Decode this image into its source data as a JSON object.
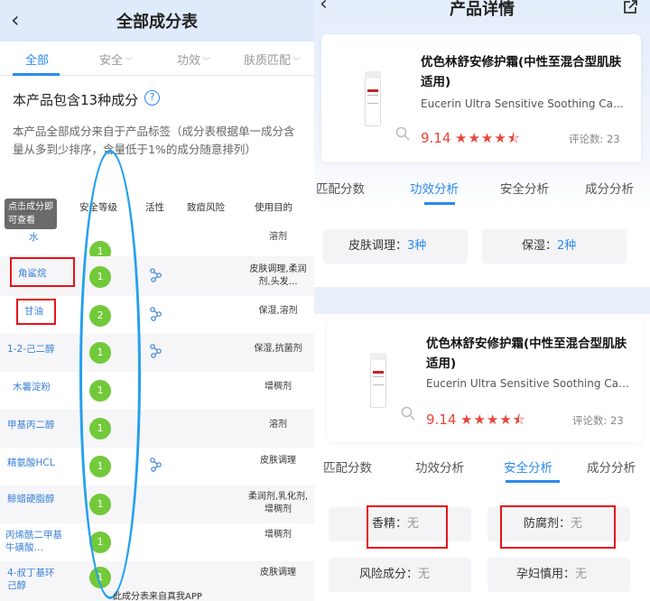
{
  "left": {
    "header": {
      "back": "‹",
      "title": "全部成分表"
    },
    "tabs": [
      {
        "label": "全部",
        "active": true
      },
      {
        "label": "安全",
        "active": false
      },
      {
        "label": "功效",
        "active": false
      },
      {
        "label": "肤质匹配",
        "active": false
      }
    ],
    "count_text": "本产品包含13种成分",
    "help_icon": "question-circle-icon",
    "description": "本产品全部成分来自于产品标签（成分表根据单一成分含量从多到少排序，含量低于1%的成分随意排列）",
    "table_headers": {
      "name": "成分",
      "safety": "安全等级",
      "activity": "活性",
      "acne_risk": "致痘风险",
      "purpose": "使用目的"
    },
    "tooltip": "点击成分即可查看",
    "rows": [
      {
        "name": "水",
        "score": "1",
        "active": false,
        "purpose": "溶剂"
      },
      {
        "name": "角鲨烷",
        "score": "1",
        "active": true,
        "purpose": "皮肤调理,柔润剂,头发…"
      },
      {
        "name": "甘油",
        "score": "2",
        "active": true,
        "purpose": "保湿,溶剂"
      },
      {
        "name": "1-2-己二醇",
        "score": "1",
        "active": true,
        "purpose": "保湿,抗菌剂"
      },
      {
        "name": "木薯淀粉",
        "score": "1",
        "active": false,
        "purpose": "增稠剂"
      },
      {
        "name": "甲基丙二醇",
        "score": "1",
        "active": false,
        "purpose": "溶剂"
      },
      {
        "name": "精氨酸HCL",
        "score": "1",
        "active": true,
        "purpose": "皮肤调理"
      },
      {
        "name": "鲸蜡硬脂醇",
        "score": "1",
        "active": false,
        "purpose": "柔润剂,乳化剂,增稠剂"
      },
      {
        "name": "丙烯酰二甲基牛磺酸…",
        "score": "1",
        "active": false,
        "purpose": "增稠剂"
      },
      {
        "name": "4-叔丁基环己醇",
        "score": "1",
        "active": false,
        "purpose": "皮肤调理"
      }
    ],
    "footer": "此成分表来自真我APP",
    "colors": {
      "accent": "#2a8af0",
      "score_green": "#72c93a",
      "highlight_red": "#e8141a",
      "annotation_blue": "#24a0ee"
    }
  },
  "right": {
    "header": {
      "back": "‹",
      "title": "产品详情",
      "share_icon": "share-icon"
    },
    "card1": {
      "name": "优色林舒安修护霜(中性至混合型肌肤适用)",
      "english_name": "Eucerin Ultra Sensitive Soothing Ca…",
      "score": "9.14",
      "rating": 4.5,
      "reviews": "评论数: 23"
    },
    "tabs1": [
      {
        "label": "匹配分数",
        "active": false
      },
      {
        "label": "功效分析",
        "active": true
      },
      {
        "label": "安全分析",
        "active": false
      },
      {
        "label": "成分分析",
        "active": false
      }
    ],
    "efficacy": [
      {
        "label": "皮肤调理：",
        "value": "3种"
      },
      {
        "label": "保湿：",
        "value": "2种"
      }
    ],
    "card2": {
      "name": "优色林舒安修护霜(中性至混合型肌肤适用)",
      "english_name": "Eucerin Ultra Sensitive Soothing Ca…",
      "score": "9.14",
      "rating": 4.5,
      "reviews": "评论数: 23"
    },
    "tabs2": [
      {
        "label": "匹配分数",
        "active": false
      },
      {
        "label": "功效分析",
        "active": false
      },
      {
        "label": "安全分析",
        "active": true
      },
      {
        "label": "成分分析",
        "active": false
      }
    ],
    "safety": [
      {
        "label": "香精：",
        "value": "无"
      },
      {
        "label": "防腐剂：",
        "value": "无"
      },
      {
        "label": "风险成分：",
        "value": "无"
      },
      {
        "label": "孕妇慎用：",
        "value": "无"
      }
    ]
  }
}
